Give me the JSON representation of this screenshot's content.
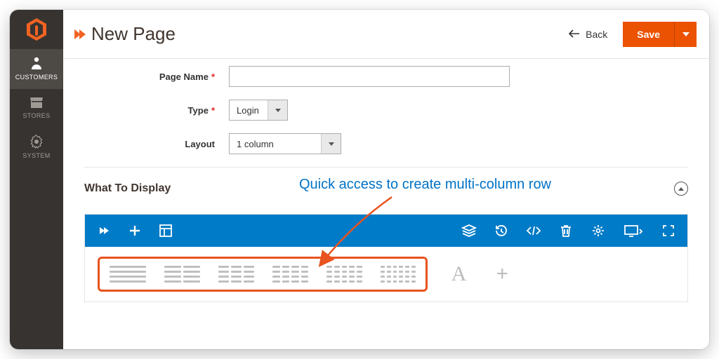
{
  "sidebar": {
    "items": [
      {
        "label": "CUSTOMERS"
      },
      {
        "label": "STORES"
      },
      {
        "label": "SYSTEM"
      }
    ]
  },
  "header": {
    "title": "New Page",
    "back_label": "Back",
    "save_label": "Save"
  },
  "form": {
    "page_name": {
      "label": "Page Name",
      "value": ""
    },
    "type": {
      "label": "Type",
      "value": "Login"
    },
    "layout": {
      "label": "Layout",
      "value": "1 column"
    }
  },
  "section": {
    "title": "What To Display"
  },
  "annotation": {
    "text": "Quick access to create multi-column row"
  },
  "colors": {
    "accent_orange": "#eb5202",
    "brand_orange": "#f26322",
    "toolbar_blue": "#007bc7",
    "highlight_border": "#e8531f",
    "anno_blue": "#0072c6"
  }
}
